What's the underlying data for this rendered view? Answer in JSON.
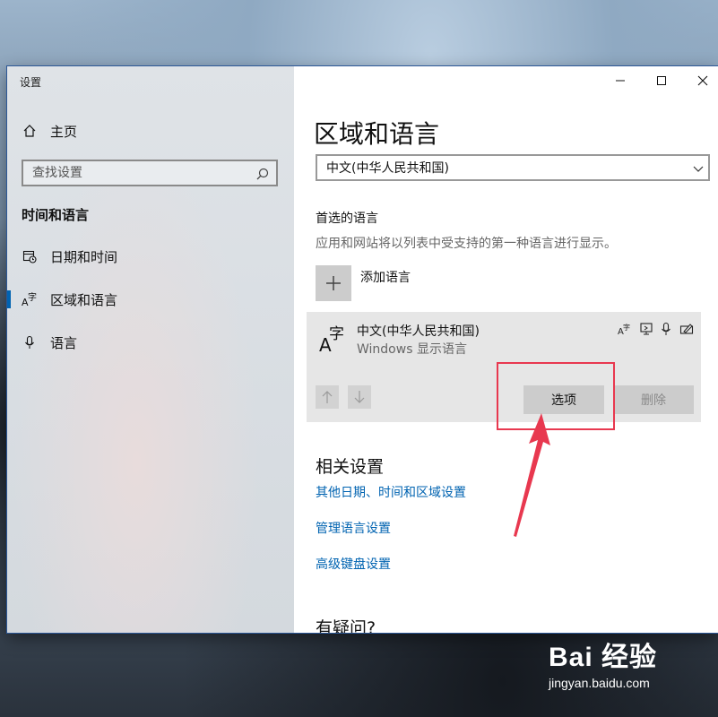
{
  "window": {
    "app_title": "设置"
  },
  "sidebar": {
    "home_label": "主页",
    "search_placeholder": "查找设置",
    "section_title": "时间和语言",
    "items": [
      {
        "label": "日期和时间",
        "icon": "calendar-clock-icon"
      },
      {
        "label": "区域和语言",
        "icon": "region-language-icon",
        "active": true
      },
      {
        "label": "语言",
        "icon": "microphone-icon"
      }
    ]
  },
  "main": {
    "page_title": "区域和语言",
    "region_select_value": "中文(中华人民共和国)",
    "preferred_heading": "首选的语言",
    "preferred_desc": "应用和网站将以列表中受支持的第一种语言进行显示。",
    "add_language_label": "添加语言",
    "language_card": {
      "name": "中文(中华人民共和国)",
      "sub": "Windows 显示语言",
      "feature_icons": [
        "display-language-icon",
        "text-to-speech-icon",
        "speech-recognition-icon",
        "handwriting-icon"
      ],
      "options_label": "选项",
      "remove_label": "删除"
    },
    "related_heading": "相关设置",
    "links": [
      "其他日期、时间和区域设置",
      "管理语言设置",
      "高级键盘设置"
    ],
    "question_heading": "有疑问?"
  },
  "watermark": {
    "logo_text": "Bai 经验",
    "url": "jingyan.baidu.com"
  },
  "colors": {
    "accent": "#0063b1",
    "annotation": "#e8384f",
    "sidebar_bg": "#dde1e5"
  }
}
